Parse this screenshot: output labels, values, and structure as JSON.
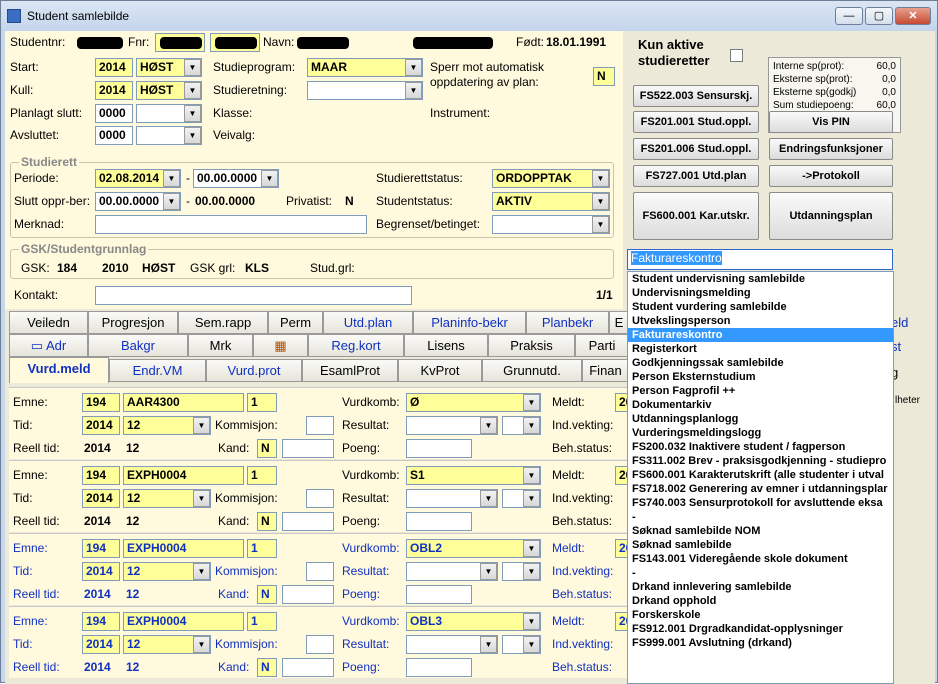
{
  "window": {
    "title": "Student samlebilde",
    "min_label": "—",
    "max_label": "▢",
    "close_label": "✕"
  },
  "header": {
    "studentnr_label": "Studentnr:",
    "fnr_label": "Fnr:",
    "navn_label": "Navn:",
    "fodt_label": "Født:",
    "fodt_value": "18.01.1991"
  },
  "form": {
    "start_label": "Start:",
    "start_year": "2014",
    "start_term": "HØST",
    "kull_label": "Kull:",
    "kull_year": "2014",
    "kull_term": "HØST",
    "planlagt_label": "Planlagt slutt:",
    "planlagt_value": "0000",
    "avsluttet_label": "Avsluttet:",
    "avsluttet_value": "0000",
    "studieprogram_label": "Studieprogram:",
    "studieprogram_value": "MAAR",
    "studieretning_label": "Studieretning:",
    "studieretning_value": "",
    "klasse_label": "Klasse:",
    "veivalg_label": "Veivalg:",
    "sperr_label": "Sperr mot automatisk oppdatering av plan:",
    "sperr_value": "N",
    "instrument_label": "Instrument:"
  },
  "studierett": {
    "group_title": "Studierett",
    "periode_label": "Periode:",
    "periode_from": "02.08.2014",
    "periode_sep": "-",
    "periode_to": "00.00.0000",
    "slutt_label": "Slutt oppr-ber:",
    "slutt_from": "00.00.0000",
    "slutt_sep": "-",
    "slutt_to": "00.00.0000",
    "privatist_label": "Privatist:",
    "privatist_value": "N",
    "studierettstatus_label": "Studierettstatus:",
    "studierettstatus_value": "ORDOPPTAK",
    "studentstatus_label": "Studentstatus:",
    "studentstatus_value": "AKTIV",
    "merknad_label": "Merknad:",
    "begrenset_label": "Begrenset/betinget:"
  },
  "gsk": {
    "group_title": "GSK/Studentgrunnlag",
    "gsk_label": "GSK:",
    "gsk_value": "184",
    "gsk_year": "2010",
    "gsk_term": "HØST",
    "grl_label": "GSK grl:",
    "grl_value": "KLS",
    "studgrl_label": "Stud.grl:"
  },
  "kontakt": {
    "label": "Kontakt:",
    "page": "1/1"
  },
  "right_panel": {
    "kun_aktive": "Kun aktive studieretter",
    "sp": [
      {
        "label": "Interne sp(prot):",
        "value": "60,0"
      },
      {
        "label": "Eksterne sp(prot):",
        "value": "0,0"
      },
      {
        "label": "Eksterne sp(godkj)",
        "value": "0,0"
      },
      {
        "label": "Sum studiepoeng:",
        "value": "60,0"
      }
    ],
    "buttons": {
      "fs522": "FS522.003 Sensurskj.",
      "fs201_001": "FS201.001 Stud.oppl.",
      "vis_pin": "Vis PIN",
      "fs201_006": "FS201.006 Stud.oppl.",
      "endring": "Endringsfunksjoner",
      "fs727": "FS727.001 Utd.plan",
      "protokoll": "->Protokoll",
      "fs600": "FS600.001 Kar.utskr.",
      "utdplan": "Utdanningsplan"
    },
    "combo_value": "Fakturareskontro"
  },
  "dropdown_items": [
    "Student undervisning samlebilde",
    "Undervisningsmelding",
    "Student vurdering samlebilde",
    "Utvekslingsperson",
    "Fakturareskontro",
    "Registerkort",
    "Godkjenningssak samlebilde",
    "Person Eksternstudium",
    "Person Fagprofil ++",
    "Dokumentarkiv",
    "Utdanningsplanlogg",
    "Vurderingsmeldingslogg",
    "FS200.032 Inaktivere student / fagperson",
    "FS311.002 Brev - praksisgodkjenning - studiepro",
    "FS600.001 Karakterutskrift (alle studenter i utval",
    "FS718.002 Generering av emner i utdanningsplar",
    "FS740.003 Sensurprotokoll for avsluttende eksa",
    "-",
    "Søknad samlebilde NOM",
    "Søknad samlebilde",
    "FS143.001 Videregående skole dokument",
    "-",
    "Drkand innlevering samlebilde",
    "Drkand opphold",
    "Forskerskole",
    "FS912.001 Drgradkandidat-opplysninger",
    "FS999.001 Avslutning (drkand)"
  ],
  "selected_item": "Fakturareskontro",
  "tabs_row1": [
    "Veiledn",
    "Progresjon",
    "Sem.rapp",
    "Perm",
    "Utd.plan",
    "Planinfo-bekr",
    "Planbekr",
    "E",
    "eld"
  ],
  "tabs_row2": [
    "Adr",
    "Bakgr",
    "Mrk",
    "",
    "Reg.kort",
    "Lisens",
    "Praksis",
    "Parti",
    "st"
  ],
  "tabs_row3": [
    "Vurd.meld",
    "Endr.VM",
    "Vurd.prot",
    "EsamlProt",
    "KvProt",
    "Grunnutd.",
    "Finan",
    "g"
  ],
  "side_text": "lheter",
  "rec_labels": {
    "emne": "Emne:",
    "tid": "Tid:",
    "reell": "Reell tid:",
    "vurdkomb": "Vurdkomb:",
    "kommisjon": "Kommisjon:",
    "kand": "Kand:",
    "resultat": "Resultat:",
    "poeng": "Poeng:",
    "meldt": "Meldt:",
    "indvekting": "Ind.vekting:",
    "behstatus": "Beh.status:"
  },
  "records": [
    {
      "inst": "194",
      "emne": "AAR4300",
      "ver": "1",
      "vurdkomb": "Ø",
      "tid_year": "2014",
      "tid_term": "12",
      "reell_year": "2014",
      "reell_term": "12",
      "kand": "N",
      "meldt": "20"
    },
    {
      "inst": "194",
      "emne": "EXPH0004",
      "ver": "1",
      "vurdkomb": "S1",
      "tid_year": "2014",
      "tid_term": "12",
      "reell_year": "2014",
      "reell_term": "12",
      "kand": "N",
      "meldt": "20"
    },
    {
      "inst": "194",
      "emne": "EXPH0004",
      "ver": "1",
      "vurdkomb": "OBL2",
      "tid_year": "2014",
      "tid_term": "12",
      "reell_year": "2014",
      "reell_term": "12",
      "kand": "N",
      "meldt": "20"
    },
    {
      "inst": "194",
      "emne": "EXPH0004",
      "ver": "1",
      "vurdkomb": "OBL3",
      "tid_year": "2014",
      "tid_term": "12",
      "reell_year": "2014",
      "reell_term": "12",
      "kand": "N",
      "meldt": "20"
    }
  ]
}
